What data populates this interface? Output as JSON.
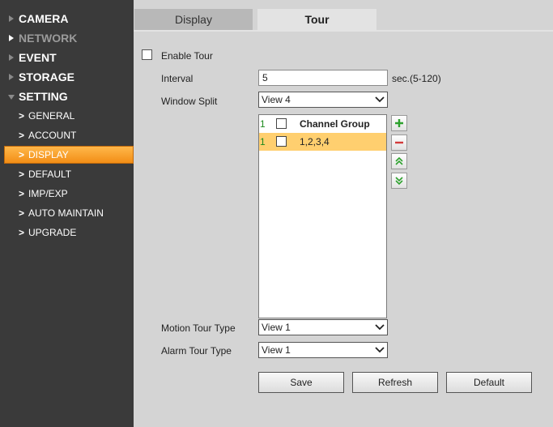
{
  "sidebar": {
    "sections": [
      {
        "label": "CAMERA"
      },
      {
        "label": "NETWORK"
      },
      {
        "label": "EVENT"
      },
      {
        "label": "STORAGE"
      },
      {
        "label": "SETTING"
      }
    ],
    "items": [
      {
        "label": "GENERAL"
      },
      {
        "label": "ACCOUNT"
      },
      {
        "label": "DISPLAY"
      },
      {
        "label": "DEFAULT"
      },
      {
        "label": "IMP/EXP"
      },
      {
        "label": "AUTO MAINTAIN"
      },
      {
        "label": "UPGRADE"
      }
    ]
  },
  "tabs": [
    {
      "label": "Display"
    },
    {
      "label": "Tour"
    }
  ],
  "form": {
    "enable_tour_label": "Enable Tour",
    "enable_tour_checked": false,
    "interval_label": "Interval",
    "interval_value": "5",
    "interval_hint": "sec.(5-120)",
    "window_split_label": "Window Split",
    "window_split_value": "View 4",
    "motion_tour_label": "Motion Tour Type",
    "motion_tour_value": "View 1",
    "alarm_tour_label": "Alarm Tour Type",
    "alarm_tour_value": "View 1"
  },
  "table": {
    "header": {
      "num": "1",
      "column": "Channel Group"
    },
    "rows": [
      {
        "num": "1",
        "channels": "1,2,3,4"
      }
    ]
  },
  "buttons": {
    "save": "Save",
    "refresh": "Refresh",
    "default": "Default"
  },
  "colors": {
    "sidebar_bg": "#3a3a3a",
    "active_item": "#f7a02f",
    "selected_row": "#ffcf6f",
    "content_bg": "#d4d4d4"
  }
}
